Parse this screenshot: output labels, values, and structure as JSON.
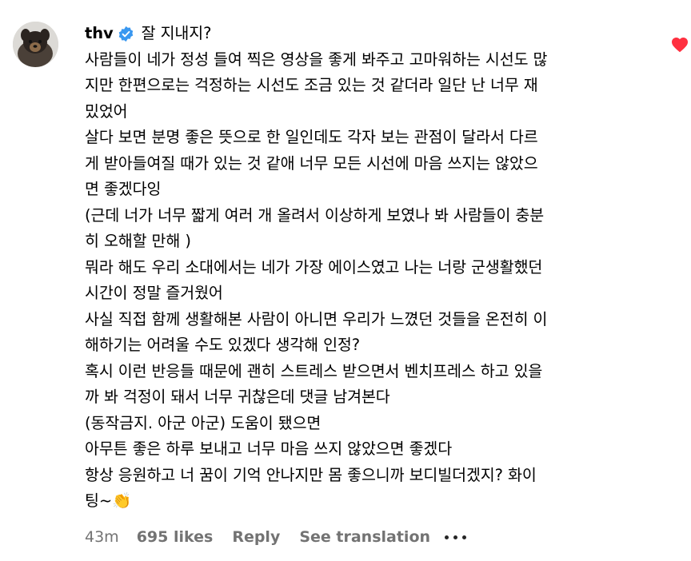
{
  "comment": {
    "username": "thv",
    "verified": true,
    "first_line": "잘 지내지?",
    "lines": [
      "사람들이 네가 정성 들여 찍은 영상을 좋게 봐주고 고마워하는 시선도 많",
      "지만 한편으로는 걱정하는 시선도 조금 있는 것 같더라 일단 난 너무 재",
      "밌었어",
      "살다 보면 분명 좋은 뜻으로 한 일인데도 각자 보는 관점이 달라서 다르",
      "게 받아들여질 때가 있는 것 같애 너무 모든 시선에 마음 쓰지는 않았으",
      "면 좋겠다잉",
      "(근데 너가 너무 짧게 여러 개 올려서 이상하게 보였나 봐 사람들이 충분",
      "히 오해할 만해 )",
      "뭐라 해도 우리 소대에서는 네가 가장 에이스였고 나는 너랑 군생활했던",
      "시간이 정말 즐거웠어",
      "사실 직접 함께 생활해본 사람이 아니면 우리가 느꼈던 것들을 온전히 이",
      "해하기는 어려울 수도 있겠다 생각해 인정?",
      "혹시 이런 반응들 때문에 괜히 스트레스 받으면서 벤치프레스 하고 있을",
      "까 봐 걱정이 돼서 너무 귀찮은데 댓글 남겨본다",
      "(동작금지. 아군 아군) 도움이 됐으면",
      "아무튼 좋은 하루 보내고 너무 마음 쓰지 않았으면 좋겠다",
      "항상 응원하고 너 꿈이 기억 안나지만 몸 좋으니까 보디빌더겠지? 화이",
      "팅~👏"
    ]
  },
  "actions": {
    "age": "43m",
    "likes": "695 likes",
    "reply": "Reply",
    "translate": "See translation"
  },
  "icons": {
    "avatar": "dog-avatar",
    "verified": "verified-badge-icon",
    "like": "heart-icon",
    "more": "more-options-icon"
  },
  "colors": {
    "verified": "#3897f0",
    "heart": "#ff3040",
    "secondary_text": "#737373"
  }
}
